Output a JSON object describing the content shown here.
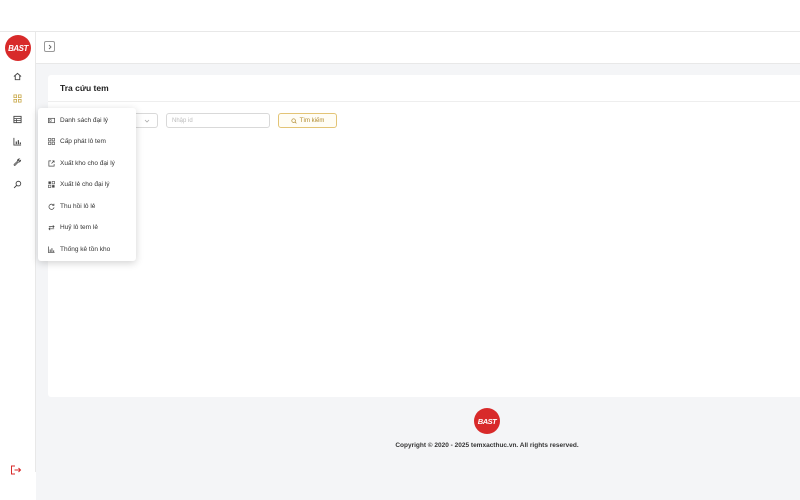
{
  "brand": {
    "logo_text": "BAST",
    "accent": "#d82a2a",
    "gold": "#e3c476"
  },
  "sidebar": {
    "items": [
      {
        "icon": "home-icon"
      },
      {
        "icon": "grid-icon"
      },
      {
        "icon": "table-icon"
      },
      {
        "icon": "chart-icon"
      },
      {
        "icon": "wrench-icon"
      },
      {
        "icon": "search-icon"
      }
    ],
    "logout_icon": "logout-icon"
  },
  "card": {
    "title": "Tra cứu tem"
  },
  "filter": {
    "input_placeholder": "Nhập id",
    "search_label": "Tìm kiếm"
  },
  "dropdown": {
    "items": [
      {
        "label": "Danh sách đại lý",
        "icon": "card-icon"
      },
      {
        "label": "Cấp phát lô tem",
        "icon": "grid-icon"
      },
      {
        "label": "Xuất kho cho đại lý",
        "icon": "export-icon"
      },
      {
        "label": "Xuất lẻ cho đại lý",
        "icon": "qr-icon"
      },
      {
        "label": "Thu hồi lô lẻ",
        "icon": "refresh-icon"
      },
      {
        "label": "Huỷ lô tem lẻ",
        "icon": "swap-icon"
      },
      {
        "label": "Thống kê tồn kho",
        "icon": "bar-chart-icon"
      }
    ]
  },
  "footer": {
    "logo_text": "BAST",
    "copyright": "Copyright © 2020 - 2025 temxacthuc.vn. All rights reserved."
  }
}
